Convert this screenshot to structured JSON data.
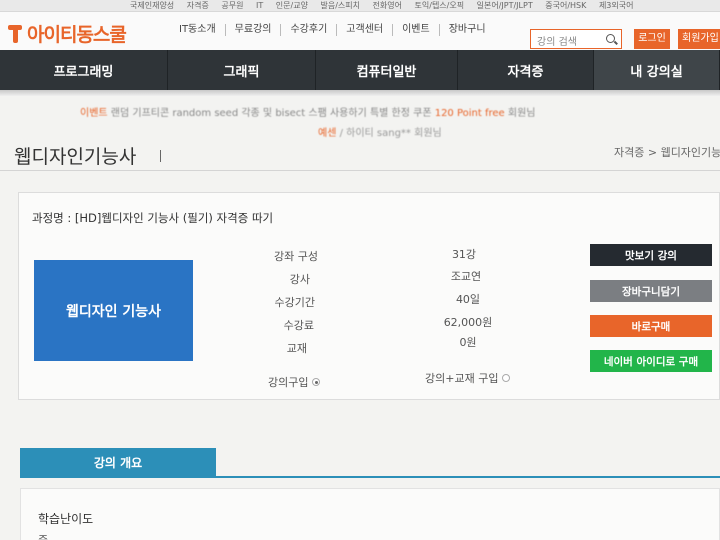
{
  "topbar": {
    "links": [
      "국제인재양성",
      "자격증",
      "공무원",
      "IT",
      "인문/교양",
      "발음/스피치",
      "전화영어",
      "토익/텝스/오픽",
      "일본어/JPT/JLPT",
      "중국어/HSK",
      "제3외국어"
    ]
  },
  "header": {
    "logo": "아이티동스쿨",
    "gnb": [
      "IT동소개",
      "무료강의",
      "수강후기",
      "고객센터",
      "이벤트",
      "장바구니"
    ],
    "search_placeholder": "강의 검색",
    "login": "로그인",
    "join": "회원가입"
  },
  "mainnav": [
    "프로그래밍",
    "그래픽",
    "컴퓨터일반",
    "자격증",
    "내 강의실"
  ],
  "notice": {
    "prefix": "이벤트",
    "text": "랜덤 기프티콘 random seed 각종 및 bisect 스팸 사용하기 특별 한정 쿠폰 ",
    "highlight": "120 Point free",
    "suffix": " 회원님"
  },
  "welcome": {
    "hl": "예센",
    "text": " / 하이티 sang** 회원님"
  },
  "page": {
    "title": "웹디자인기능사",
    "breadcrumb": "자격증 > 웹디자인기능사"
  },
  "course": {
    "name": "과정명 : [HD]웹디자인 기능사 (필기) 자격증 따기",
    "thumb_text": "웹디자인 기능사",
    "rows": [
      {
        "label": "강좌 구성",
        "value": "31강"
      },
      {
        "label": "강사",
        "value": "조교연"
      },
      {
        "label": "수강기간",
        "value": "40일"
      },
      {
        "label": "수강료",
        "value": "62,000원"
      },
      {
        "label": "교재",
        "value": "0원"
      }
    ],
    "option_lecture": "강의구입",
    "option_bundle": "강의+교재 구입",
    "buttons": {
      "preview": "맛보기 강의",
      "cart": "장바구니담기",
      "buy": "바로구매",
      "naver": "네이버 아이디로 구매"
    }
  },
  "overview": {
    "tab": "강의 개요",
    "difficulty_label": "학습난이도",
    "difficulty_value": "중"
  },
  "colors": {
    "brand": "#e8652a",
    "nav": "#2f3438",
    "thumb": "#2a74c4",
    "overview": "#2c8fb8",
    "naver": "#22b54a"
  }
}
